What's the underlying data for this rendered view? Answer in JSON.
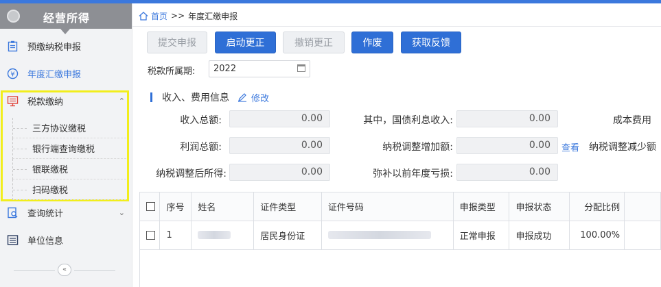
{
  "sidebar": {
    "header_title": "经营所得",
    "items": [
      {
        "label": "预缴纳税申报",
        "icon": "form-icon"
      },
      {
        "label": "年度汇缴申报",
        "icon": "yen-icon"
      },
      {
        "label": "税款缴纳",
        "icon": "payment-icon"
      },
      {
        "label": "查询统计",
        "icon": "query-icon"
      },
      {
        "label": "单位信息",
        "icon": "list-icon"
      }
    ],
    "sub_items": [
      {
        "label": "三方协议缴税"
      },
      {
        "label": "银行端查询缴税"
      },
      {
        "label": "银联缴税"
      },
      {
        "label": "扫码缴税"
      }
    ],
    "collapse_glyph": "«"
  },
  "breadcrumb": {
    "home": "首页",
    "sep": ">>",
    "current": "年度汇缴申报"
  },
  "toolbar": {
    "submit": "提交申报",
    "start_correction": "启动更正",
    "cancel_correction": "撤销更正",
    "void": "作废",
    "feedback": "获取反馈"
  },
  "period": {
    "label": "税款所属期:",
    "value": "2022"
  },
  "section": {
    "title": "收入、费用信息",
    "edit": "修改"
  },
  "fields": {
    "total_income_label": "收入总额:",
    "total_income": "0.00",
    "bond_interest_label": "其中，国债利息收入:",
    "bond_interest": "0.00",
    "cost_label": "成本费用",
    "profit_label": "利润总额:",
    "profit": "0.00",
    "adjust_increase_label": "纳税调整增加额:",
    "adjust_increase": "0.00",
    "view": "查看",
    "adjust_decrease_label": "纳税调整减少额",
    "adjusted_income_label": "纳税调整后所得:",
    "adjusted_income": "0.00",
    "prior_loss_label": "弥补以前年度亏损:",
    "prior_loss": "0.00"
  },
  "table": {
    "headers": [
      "序号",
      "姓名",
      "证件类型",
      "证件号码",
      "申报类型",
      "申报状态",
      "分配比例"
    ],
    "rows": [
      {
        "no": "1",
        "id_type": "居民身份证",
        "declare_type": "正常申报",
        "status": "申报成功",
        "ratio": "100.00%"
      }
    ]
  },
  "colors": {
    "primary": "#2f6fd6",
    "highlight": "#f2ee1c",
    "sidebar_header": "#8d8f94"
  }
}
